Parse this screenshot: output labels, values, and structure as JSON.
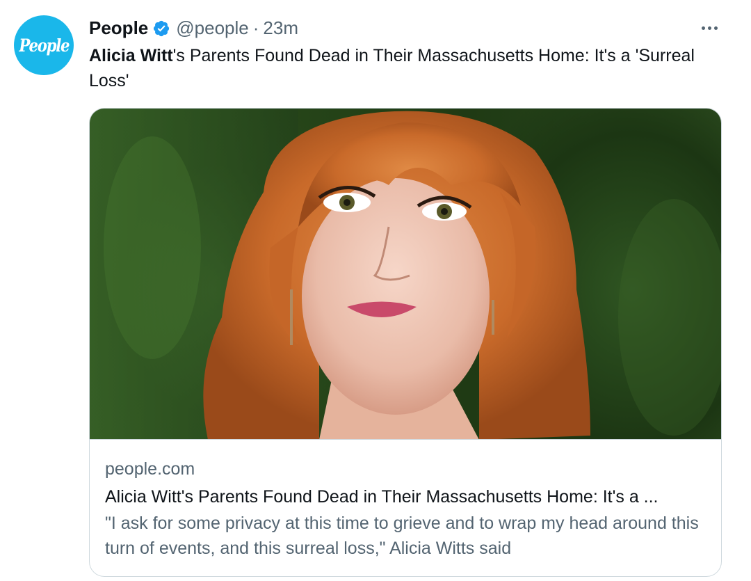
{
  "account": {
    "avatar_text": "People",
    "display_name": "People",
    "handle": "@people",
    "separator": "·",
    "timestamp": "23m",
    "verified_icon": "verified-badge-icon"
  },
  "tweet": {
    "text_bold": "Alicia Witt",
    "text_rest": "'s Parents Found Dead in Their Massachusetts Home: It's a 'Surreal Loss'"
  },
  "card": {
    "domain": "people.com",
    "title": "Alicia Witt's Parents Found Dead in Their Massachusetts Home: It's a ...",
    "description": "\"I ask for some privacy at this time to grieve and to wrap my head around this turn of events, and this surreal loss,\" Alicia Witts said"
  },
  "menu": {
    "icon": "more-options-icon"
  },
  "colors": {
    "accent": "#1d9bf0",
    "avatar_bg": "#1ab7ea",
    "secondary_text": "#536471",
    "primary_text": "#0f1419",
    "border": "#cfd9de"
  }
}
